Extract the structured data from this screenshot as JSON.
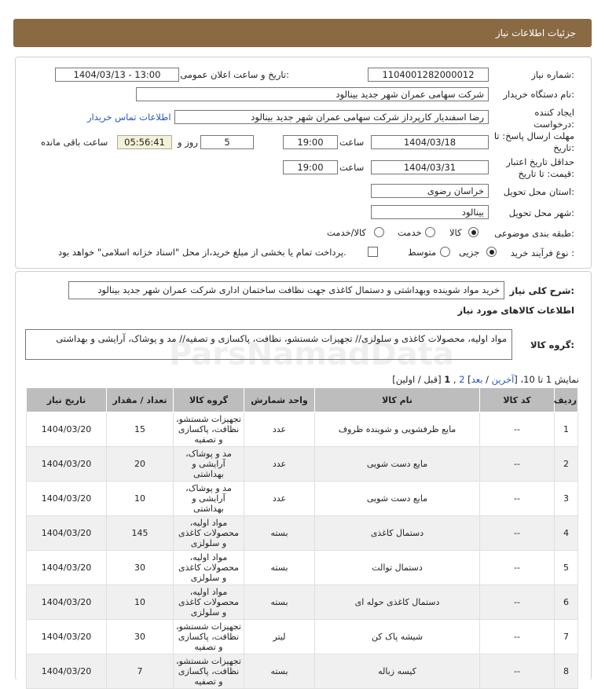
{
  "header": {
    "title": "جزئیات اطلاعات نیاز"
  },
  "form": {
    "need_number_label": "شماره نیاز:",
    "need_number": "1104001282000012",
    "announce_label": "تاریخ و ساعت اعلان عمومی:",
    "announce_value": "1404/03/13 - 13:00",
    "buyer_org_label": "نام دستگاه خریدار:",
    "buyer_org": "شرکت سهامی عمران شهر جدید بینالود",
    "creator_label": "ایجاد کننده درخواست:",
    "creator": "رضا اسفندیار کارپرداز شرکت سهامی عمران شهر جدید بینالود",
    "contact_link": "اطلاعات تماس خریدار",
    "deadline_label": "مهلت ارسال پاسخ: تا تاریخ:",
    "deadline_date": "1404/03/18",
    "time_label": "ساعت",
    "deadline_time": "19:00",
    "days_value": "5",
    "days_label": "روز و",
    "remaining_time": "05:56:41",
    "remaining_label": "ساعت باقی مانده",
    "validity_label": "حداقل تاریخ اعتبار قیمت: تا تاریخ:",
    "validity_date": "1404/03/31",
    "validity_time": "19:00",
    "province_label": "استان محل تحویل:",
    "province": "خراسان رضوی",
    "city_label": "شهر محل تحویل:",
    "city": "بینالود",
    "category_label": "طبقه بندی موضوعی:",
    "category_options": [
      "کالا",
      "خدمت",
      "کالا/خدمت"
    ],
    "category_selected": "کالا",
    "process_label": "نوع فرآیند خرید :",
    "process_options": [
      "جزیی",
      "متوسط"
    ],
    "process_selected": "جزیی",
    "payment_note": "پرداخت تمام یا بخشی از مبلغ خرید،از محل \"اسناد خزانه اسلامی\" خواهد بود."
  },
  "summary": {
    "label": "شرح کلی نیاز:",
    "text": "خرید مواد شوینده وبهداشتی و دستمال کاغذی جهت نظافت ساختمان اداری شرکت عمران شهر جدید بینالود",
    "items_title": "اطلاعات کالاهای مورد نیاز",
    "group_label": "گروه کالا:",
    "group_text": "مواد اولیه، محصولات کاغذی و سلولزی// تجهیزات شستشو، نظافت، پاکسازی و تصفیه// مد و پوشاک، آرایشی و بهداشتی"
  },
  "pager": {
    "prefix": "نمایش 1 تا 10، [",
    "last": "آخرین",
    "sep1": " / ",
    "next": "بعد",
    "close1": "] ",
    "page2": "2",
    "comma": " ,",
    "page1": "1",
    "rest": " [قبل / اولین]"
  },
  "table": {
    "headers": [
      "ردیف",
      "کد کالا",
      "نام کالا",
      "واحد شمارش",
      "گروه کالا",
      "تعداد / مقدار",
      "تاریخ نیاز"
    ],
    "rows": [
      {
        "row": "1",
        "code": "--",
        "name": "مایع ظرفشویی و شوینده ظروف",
        "unit": "عدد",
        "group": "تجهیزات شستشو، نظافت، پاکسازی و تصفیه",
        "qty": "15",
        "date": "1404/03/20"
      },
      {
        "row": "2",
        "code": "--",
        "name": "مایع دست شویی",
        "unit": "عدد",
        "group": "مد و پوشاک، آرایشی و بهداشتی",
        "qty": "20",
        "date": "1404/03/20"
      },
      {
        "row": "3",
        "code": "--",
        "name": "مایع دست شویی",
        "unit": "عدد",
        "group": "مد و پوشاک، آرایشی و بهداشتی",
        "qty": "10",
        "date": "1404/03/20"
      },
      {
        "row": "4",
        "code": "--",
        "name": "دستمال کاغذی",
        "unit": "بسته",
        "group": "مواد اولیه، محصولات کاغذی و سلولزی",
        "qty": "145",
        "date": "1404/03/20"
      },
      {
        "row": "5",
        "code": "--",
        "name": "دستمال توالت",
        "unit": "بسته",
        "group": "مواد اولیه، محصولات کاغذی و سلولزی",
        "qty": "30",
        "date": "1404/03/20"
      },
      {
        "row": "6",
        "code": "--",
        "name": "دستمال کاغذی حوله ای",
        "unit": "بسته",
        "group": "مواد اولیه، محصولات کاغذی و سلولزی",
        "qty": "10",
        "date": "1404/03/20"
      },
      {
        "row": "7",
        "code": "--",
        "name": "شیشه پاک کن",
        "unit": "لیتر",
        "group": "تجهیزات شستشو، نظافت، پاکسازی و تصفیه",
        "qty": "30",
        "date": "1404/03/20"
      },
      {
        "row": "8",
        "code": "--",
        "name": "کیسه زباله",
        "unit": "بسته",
        "group": "تجهیزات شستشو، نظافت، پاکسازی و تصفیه",
        "qty": "7",
        "date": "1404/03/20"
      }
    ]
  },
  "watermark": {
    "line1": "ParsNamadData",
    "line2": "۰۲۱-۸۸۳۴۹۶۷۰-۵"
  },
  "colors": {
    "header_bg": "#8a6a43",
    "table_header_bg": "#bdbdbd",
    "link": "#2857b8"
  }
}
